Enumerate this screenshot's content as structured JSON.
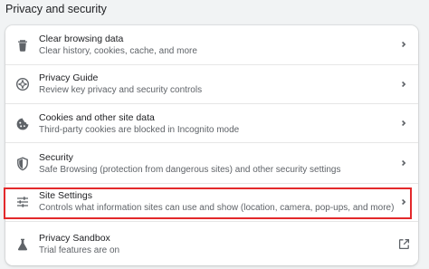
{
  "section_title": "Privacy and security",
  "items": [
    {
      "title": "Clear browsing data",
      "description": "Clear history, cookies, cache, and more",
      "icon": "trash-icon",
      "trailing": "chevron-right-icon"
    },
    {
      "title": "Privacy Guide",
      "description": "Review key privacy and security controls",
      "icon": "compass-icon",
      "trailing": "chevron-right-icon"
    },
    {
      "title": "Cookies and other site data",
      "description": "Third-party cookies are blocked in Incognito mode",
      "icon": "cookie-icon",
      "trailing": "chevron-right-icon"
    },
    {
      "title": "Security",
      "description": "Safe Browsing (protection from dangerous sites) and other security settings",
      "icon": "shield-icon",
      "trailing": "chevron-right-icon"
    },
    {
      "title": "Site Settings",
      "description": "Controls what information sites can use and show (location, camera, pop-ups, and more)",
      "icon": "tune-icon",
      "trailing": "chevron-right-icon"
    },
    {
      "title": "Privacy Sandbox",
      "description": "Trial features are on",
      "icon": "flask-icon",
      "trailing": "external-link-icon"
    }
  ],
  "colors": {
    "highlight_border": "#e3292b",
    "icon": "#5f6368",
    "page_background": "#f1f3f4",
    "card_background": "#ffffff"
  }
}
